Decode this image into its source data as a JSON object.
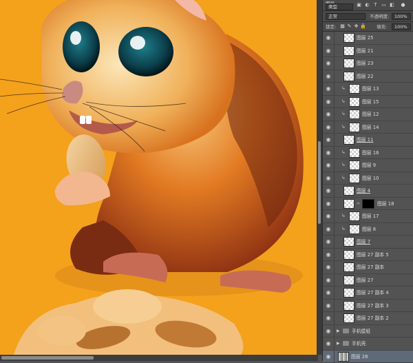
{
  "canvas": {
    "artwork": "chipmunk-illustration",
    "background_color": "#f4a11c"
  },
  "panel": {
    "header": {
      "tab": "图层"
    },
    "filter": {
      "kind": "类型"
    },
    "blend": {
      "mode": "正常",
      "opacity_label": "不透明度:",
      "opacity_value": "100%"
    },
    "lock": {
      "label": "锁定:",
      "fill_label": "填充:",
      "fill_value": "100%"
    },
    "layers": [
      {
        "name": "图层 25",
        "indent": 1,
        "type": "layer"
      },
      {
        "name": "图层 21",
        "indent": 1,
        "type": "layer"
      },
      {
        "name": "图层 23",
        "indent": 1,
        "type": "layer"
      },
      {
        "name": "图层 22",
        "indent": 1,
        "type": "layer"
      },
      {
        "name": "图层 13",
        "indent": 1,
        "type": "clipped"
      },
      {
        "name": "图层 15",
        "indent": 1,
        "type": "clipped"
      },
      {
        "name": "图层 12",
        "indent": 1,
        "type": "clipped"
      },
      {
        "name": "图层 14",
        "indent": 1,
        "type": "clipped"
      },
      {
        "name": "图层 11",
        "indent": 1,
        "type": "layer",
        "underline": true
      },
      {
        "name": "图层 16",
        "indent": 1,
        "type": "clipped"
      },
      {
        "name": "图层 9",
        "indent": 1,
        "type": "clipped"
      },
      {
        "name": "图层 10",
        "indent": 1,
        "type": "clipped"
      },
      {
        "name": "图层 4",
        "indent": 1,
        "type": "layer",
        "underline": true
      },
      {
        "name": "图层 18",
        "indent": 1,
        "type": "masked"
      },
      {
        "name": "图层 17",
        "indent": 1,
        "type": "clipped"
      },
      {
        "name": "图层 8",
        "indent": 1,
        "type": "clipped"
      },
      {
        "name": "图层 7",
        "indent": 1,
        "type": "layer",
        "underline": true
      },
      {
        "name": "图层 27 副本 5",
        "indent": 1,
        "type": "layer"
      },
      {
        "name": "图层 27 副本",
        "indent": 1,
        "type": "layer"
      },
      {
        "name": "图层 27",
        "indent": 1,
        "type": "layer"
      },
      {
        "name": "图层 27 副本 4",
        "indent": 1,
        "type": "layer"
      },
      {
        "name": "图层 27 副本 3",
        "indent": 1,
        "type": "layer"
      },
      {
        "name": "图层 27 副本 2",
        "indent": 1,
        "type": "layer"
      },
      {
        "name": "手机壁纸",
        "indent": 0,
        "type": "group"
      },
      {
        "name": "手机壳",
        "indent": 0,
        "type": "group"
      },
      {
        "name": "图层 28",
        "indent": 0,
        "type": "background",
        "selected": true
      }
    ]
  }
}
